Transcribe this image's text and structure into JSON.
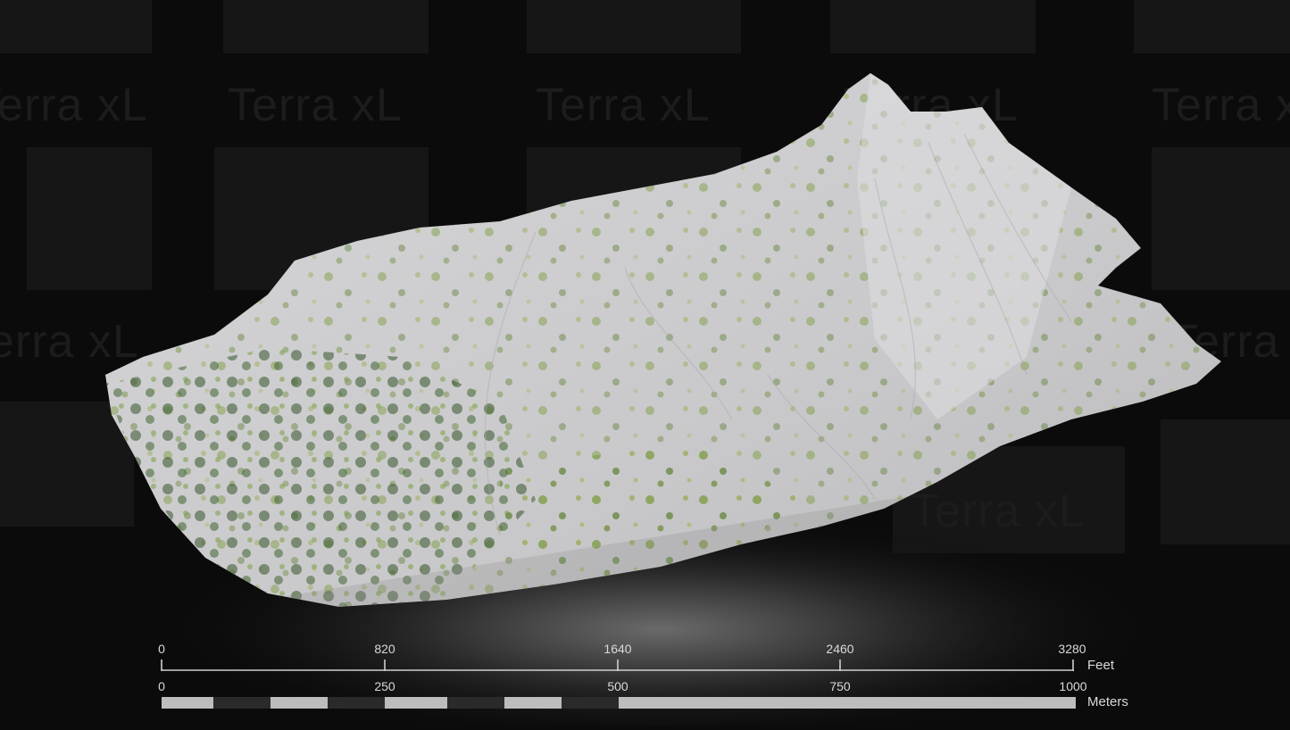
{
  "watermark": {
    "brand": "Terra xL"
  },
  "terrain_model": {
    "description_icon": "mountain-3d-model",
    "colors": {
      "rock": "#cfcfd1",
      "vegetation": "#6f8f3a",
      "trees": "#3d5e2c",
      "background": "#0b0b0b"
    }
  },
  "scale_bar": {
    "feet": {
      "unit": "Feet",
      "ticks": [
        "0",
        "820",
        "1640",
        "2460",
        "3280"
      ],
      "max": 3280
    },
    "meters": {
      "unit": "Meters",
      "ticks": [
        "0",
        "250",
        "500",
        "750",
        "1000"
      ],
      "max": 1000
    }
  }
}
